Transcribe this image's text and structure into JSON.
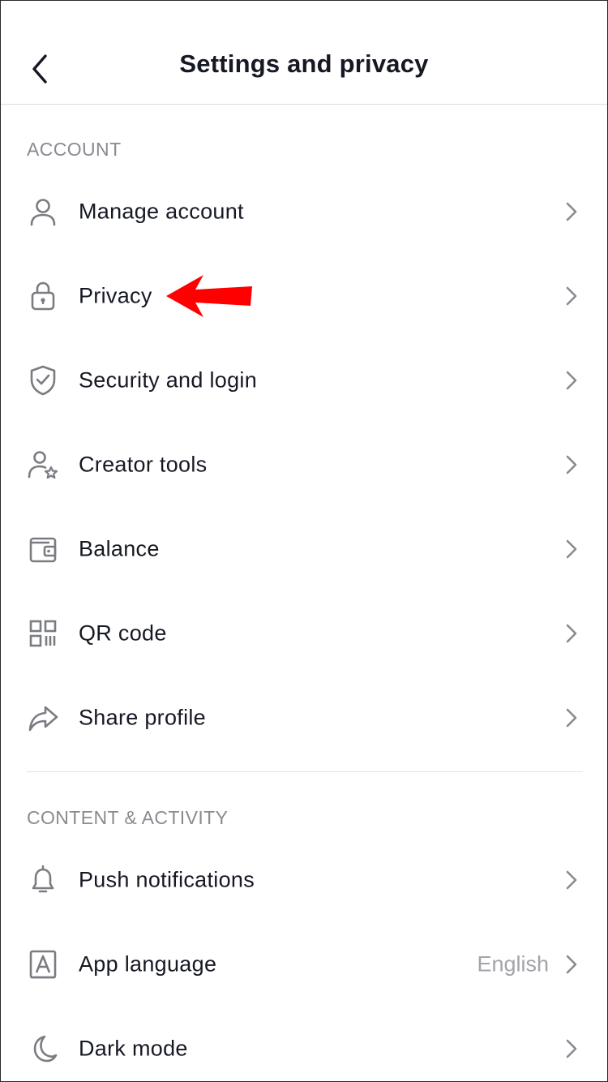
{
  "header": {
    "title": "Settings and privacy",
    "back_icon": "chevron-left-icon"
  },
  "sections": [
    {
      "label": "ACCOUNT",
      "items": [
        {
          "label": "Manage account",
          "icon": "person-icon"
        },
        {
          "label": "Privacy",
          "icon": "lock-icon"
        },
        {
          "label": "Security and login",
          "icon": "shield-check-icon"
        },
        {
          "label": "Creator tools",
          "icon": "person-star-icon"
        },
        {
          "label": "Balance",
          "icon": "wallet-icon"
        },
        {
          "label": "QR code",
          "icon": "qr-code-icon"
        },
        {
          "label": "Share profile",
          "icon": "share-arrow-icon"
        }
      ]
    },
    {
      "label": "CONTENT & ACTIVITY",
      "items": [
        {
          "label": "Push notifications",
          "icon": "bell-icon"
        },
        {
          "label": "App language",
          "icon": "language-a-icon",
          "value": "English"
        },
        {
          "label": "Dark mode",
          "icon": "moon-icon"
        }
      ]
    }
  ],
  "annotation": {
    "icon": "red-arrow-pointer",
    "color": "#ff0000"
  },
  "colors": {
    "text": "#161823",
    "secondary": "#8a8b91",
    "icon": "#7b7c82"
  }
}
